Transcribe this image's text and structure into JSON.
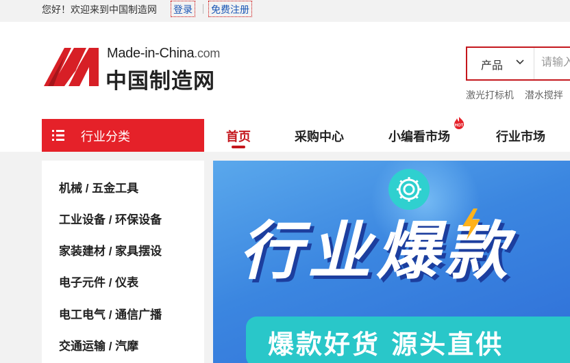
{
  "topbar": {
    "welcome": "您好！欢迎来到中国制造网",
    "login": "登录",
    "register": "免费注册"
  },
  "logo": {
    "en_main": "Made-in-China",
    "en_suffix": ".com",
    "cn": "中国制造网"
  },
  "search": {
    "category": "产品",
    "placeholder": "请输入",
    "hotwords": [
      "激光打标机",
      "潜水搅拌"
    ]
  },
  "nav": {
    "category_label": "行业分类",
    "items": [
      {
        "label": "首页"
      },
      {
        "label": "采购中心"
      },
      {
        "label": "小编看市场"
      },
      {
        "label": "行业市场"
      }
    ],
    "hot_badge": "HOT"
  },
  "sidebar": {
    "items": [
      {
        "label": "机械 / 五金工具"
      },
      {
        "label": "工业设备 / 环保设备"
      },
      {
        "label": "家装建材 / 家具摆设"
      },
      {
        "label": "电子元件 / 仪表"
      },
      {
        "label": "电工电气 / 通信广播"
      },
      {
        "label": "交通运输 / 汽摩"
      }
    ]
  },
  "banner": {
    "title": "行业爆款",
    "subtitle": "爆款好货 源头直供"
  },
  "colors": {
    "brand_red": "#e52129",
    "link_blue": "#1a56b5",
    "banner_blue": "#3b86e0",
    "banner_teal": "#29c7c9"
  }
}
